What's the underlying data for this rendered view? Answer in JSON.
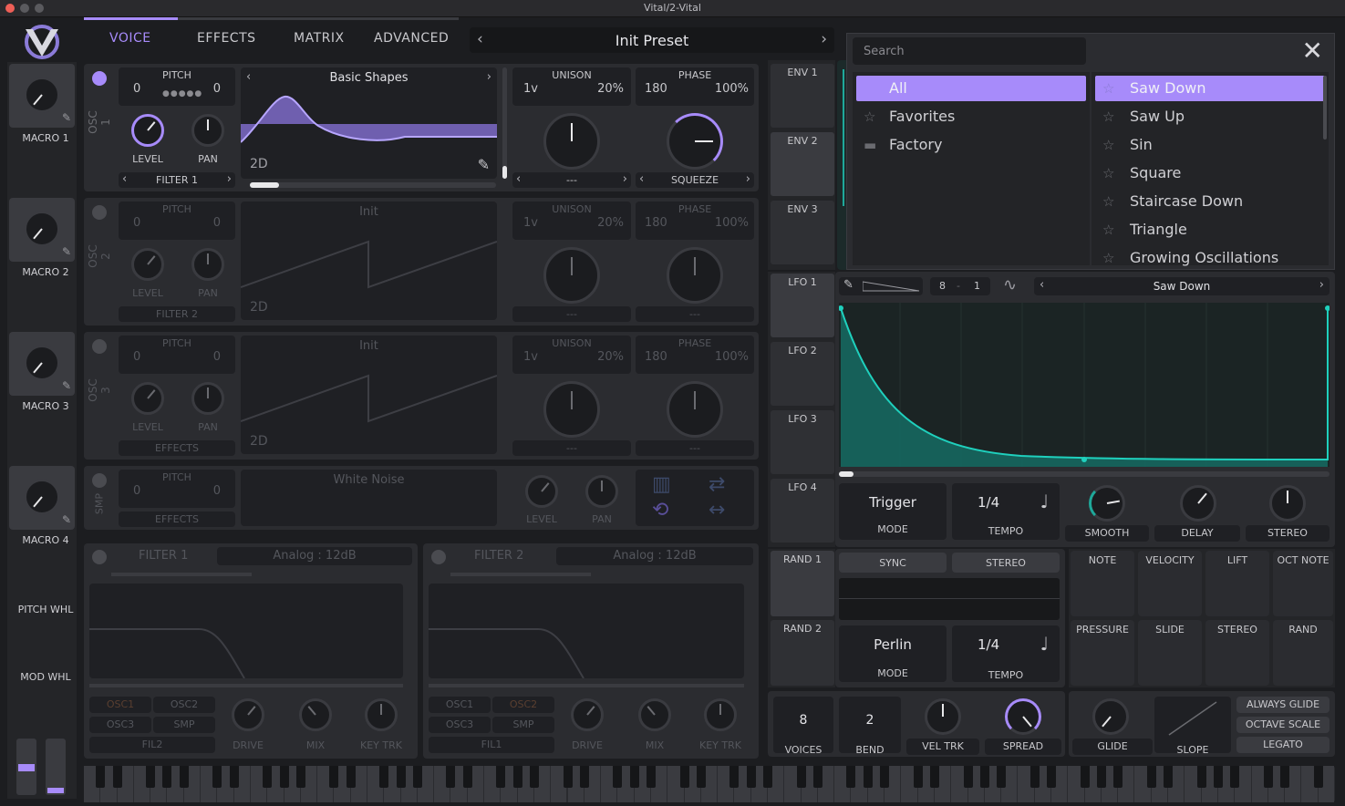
{
  "window_title": "Vital/2-Vital",
  "tabs": [
    {
      "label": "VOICE"
    },
    {
      "label": "EFFECTS"
    },
    {
      "label": "MATRIX"
    },
    {
      "label": "ADVANCED"
    }
  ],
  "preset": {
    "name": "Init Preset"
  },
  "macros": [
    {
      "label": "MACRO 1"
    },
    {
      "label": "MACRO 2"
    },
    {
      "label": "MACRO 3"
    },
    {
      "label": "MACRO 4"
    }
  ],
  "wheels": {
    "pitch": "PITCH WHL",
    "mod": "MOD WHL"
  },
  "osc": [
    {
      "side": "OSC 1",
      "pitch_label": "PITCH",
      "pitch_left": "0",
      "pitch_right": "0",
      "level": "LEVEL",
      "pan": "PAN",
      "dest": "FILTER 1",
      "wavetable": "Basic Shapes",
      "mode": "2D",
      "unison_label": "UNISON",
      "unison_voices": "1v",
      "unison_detune": "20%",
      "phase_label": "PHASE",
      "phase_value": "180",
      "phase_amount": "100%",
      "unison_dest": "---",
      "phase_dest": "SQUEEZE"
    },
    {
      "side": "OSC 2",
      "pitch_label": "PITCH",
      "pitch_left": "0",
      "pitch_right": "0",
      "level": "LEVEL",
      "pan": "PAN",
      "dest": "FILTER 2",
      "wavetable": "Init",
      "mode": "2D",
      "unison_label": "UNISON",
      "unison_voices": "1v",
      "unison_detune": "20%",
      "phase_label": "PHASE",
      "phase_value": "180",
      "phase_amount": "100%",
      "unison_dest": "---",
      "phase_dest": "---"
    },
    {
      "side": "OSC 3",
      "pitch_label": "PITCH",
      "pitch_left": "0",
      "pitch_right": "0",
      "level": "LEVEL",
      "pan": "PAN",
      "dest": "EFFECTS",
      "wavetable": "Init",
      "mode": "2D",
      "unison_label": "UNISON",
      "unison_voices": "1v",
      "unison_detune": "20%",
      "phase_label": "PHASE",
      "phase_value": "180",
      "phase_amount": "100%",
      "unison_dest": "---",
      "phase_dest": "---"
    }
  ],
  "smp": {
    "side": "SMP",
    "pitch_label": "PITCH",
    "pitch_left": "0",
    "pitch_right": "0",
    "dest": "EFFECTS",
    "sample": "White Noise",
    "level": "LEVEL",
    "pan": "PAN"
  },
  "filters": [
    {
      "title": "FILTER 1",
      "model": "Analog : 12dB",
      "src1": "OSC1",
      "src2": "OSC2",
      "src3": "OSC3",
      "src4": "SMP",
      "fil": "FIL2",
      "drive": "DRIVE",
      "mix": "MIX",
      "keytrk": "KEY TRK"
    },
    {
      "title": "FILTER 2",
      "model": "Analog : 12dB",
      "src1": "OSC1",
      "src2": "OSC2",
      "src3": "OSC3",
      "src4": "SMP",
      "fil": "FIL1",
      "drive": "DRIVE",
      "mix": "MIX",
      "keytrk": "KEY TRK"
    }
  ],
  "envelopes": [
    {
      "label": "ENV 1"
    },
    {
      "label": "ENV 2"
    },
    {
      "label": "ENV 3"
    }
  ],
  "lfos": [
    {
      "label": "LFO 1"
    },
    {
      "label": "LFO 2"
    },
    {
      "label": "LFO 3"
    },
    {
      "label": "LFO 4"
    }
  ],
  "lfo_editor": {
    "grid_x": "8",
    "grid_y": "1",
    "shape": "Saw Down",
    "mode_value": "Trigger",
    "mode_label": "MODE",
    "tempo_value": "1/4",
    "tempo_label": "TEMPO",
    "smooth": "SMOOTH",
    "delay": "DELAY",
    "stereo": "STEREO"
  },
  "browser": {
    "search_placeholder": "Search",
    "folders": [
      {
        "label": "All"
      },
      {
        "label": "Favorites"
      },
      {
        "label": "Factory"
      }
    ],
    "items": [
      {
        "label": "Saw Down"
      },
      {
        "label": "Saw Up"
      },
      {
        "label": "Sin"
      },
      {
        "label": "Square"
      },
      {
        "label": "Staircase Down"
      },
      {
        "label": "Triangle"
      },
      {
        "label": "Growing Oscillations"
      }
    ]
  },
  "rand": [
    {
      "label": "RAND 1"
    },
    {
      "label": "RAND 2"
    }
  ],
  "rand_editor": {
    "sync": "SYNC",
    "stereo": "STEREO",
    "mode_value": "Perlin",
    "mode_label": "MODE",
    "tempo_value": "1/4",
    "tempo_label": "TEMPO"
  },
  "mod_sources": [
    {
      "label": "NOTE"
    },
    {
      "label": "VELOCITY"
    },
    {
      "label": "LIFT"
    },
    {
      "label": "OCT NOTE"
    },
    {
      "label": "PRESSURE"
    },
    {
      "label": "SLIDE"
    },
    {
      "label": "STEREO"
    },
    {
      "label": "RAND"
    }
  ],
  "voice": {
    "voices_value": "8",
    "voices_label": "VOICES",
    "bend_value": "2",
    "bend_label": "BEND",
    "veltrk": "VEL TRK",
    "spread": "SPREAD"
  },
  "glide": {
    "glide": "GLIDE",
    "slope": "SLOPE",
    "always": "ALWAYS GLIDE",
    "octave": "OCTAVE SCALE",
    "legato": "LEGATO"
  },
  "colors": {
    "accent": "#a78bfa",
    "lfo": "#1fa89a",
    "bg": "#1c1d20",
    "panel": "#2b2c30"
  }
}
